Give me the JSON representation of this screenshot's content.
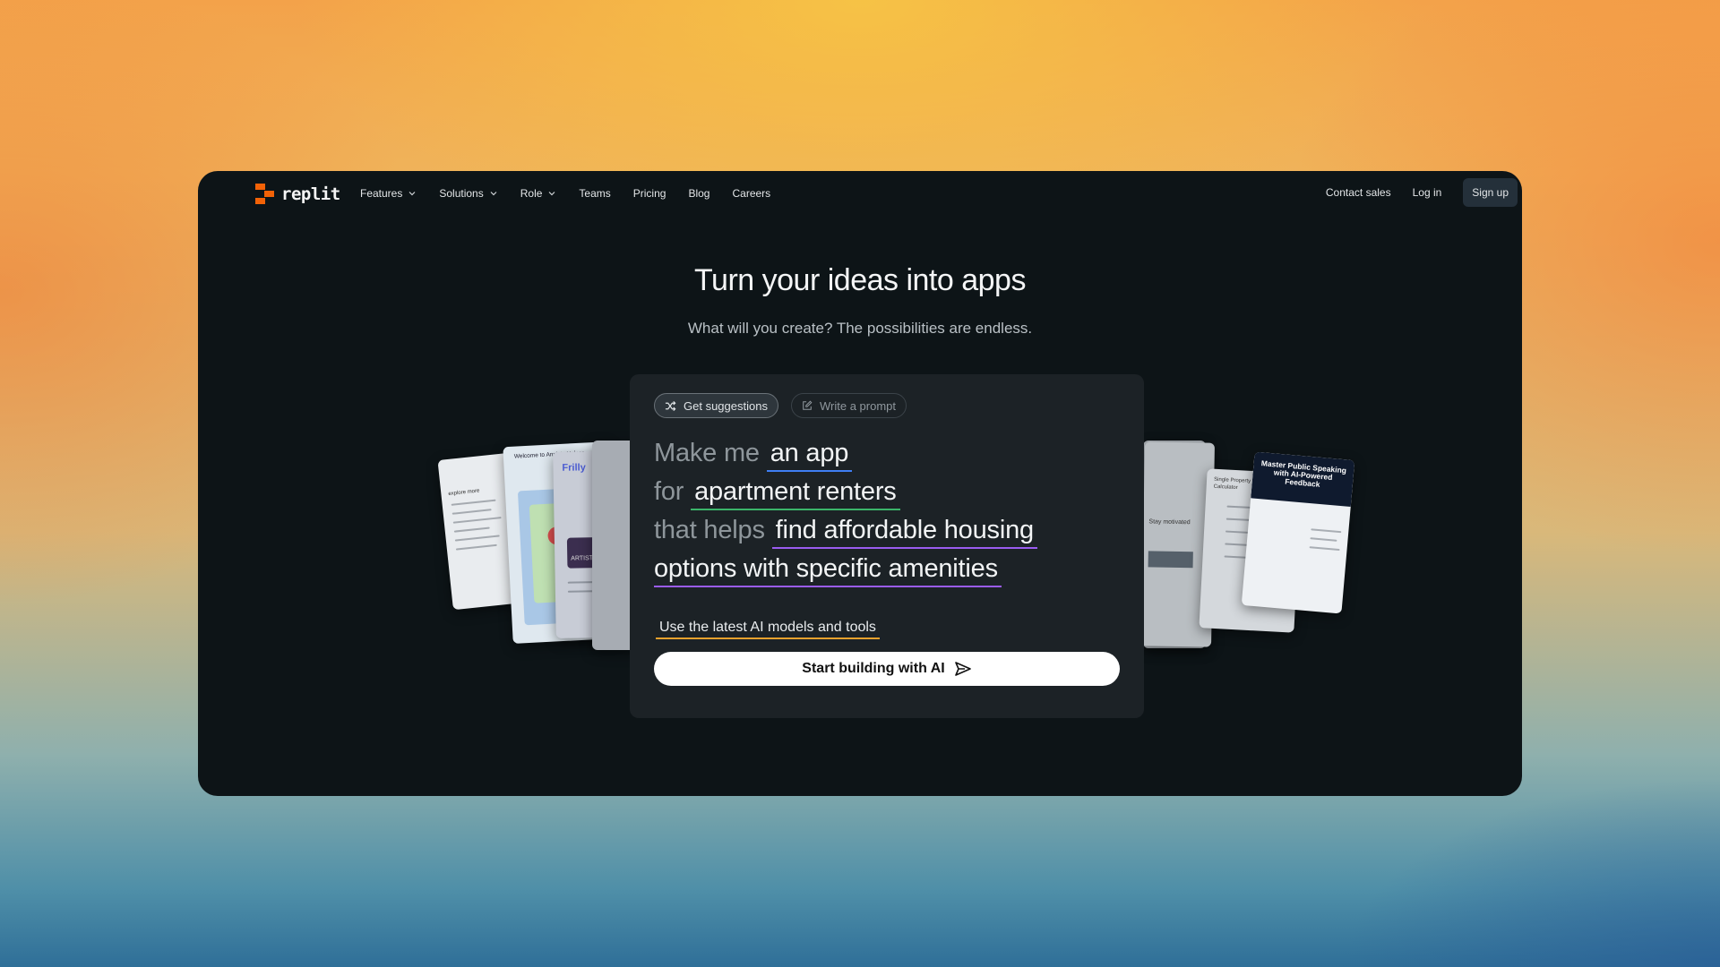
{
  "brand": {
    "logo_text": "replit",
    "accent": "#f26207"
  },
  "nav": {
    "items": [
      {
        "label": "Features",
        "dropdown": true
      },
      {
        "label": "Solutions",
        "dropdown": true
      },
      {
        "label": "Role",
        "dropdown": true
      },
      {
        "label": "Teams",
        "dropdown": false
      },
      {
        "label": "Pricing",
        "dropdown": false
      },
      {
        "label": "Blog",
        "dropdown": false
      },
      {
        "label": "Careers",
        "dropdown": false
      }
    ],
    "contact_sales": "Contact sales",
    "login": "Log in",
    "signup": "Sign up"
  },
  "hero": {
    "title": "Turn your ideas into apps",
    "subtitle": "What will you create? The possibilities are endless."
  },
  "prompt_card": {
    "tabs": {
      "suggestions": "Get suggestions",
      "write": "Write a prompt"
    },
    "line1_prefix": "Make me",
    "line1_value": "an app",
    "line2_prefix": "for",
    "line2_value": "apartment renters",
    "line3_prefix": "that helps",
    "line3_value": "find affordable housing",
    "line4_value": "options with specific amenities",
    "tools_label": "Use the latest AI models and tools",
    "cta_label": "Start building with AI"
  },
  "preview_cards": {
    "left_1": "explore more",
    "left_2": "Welcome to Anxiety Helper",
    "left_3": "Frilly",
    "left_4": "ARTIST",
    "right_1": "Stay motivated",
    "right_2": "Single Property Loan Calculator",
    "right_3": "Master Public Speaking with AI-Powered Feedback"
  },
  "colors": {
    "window_bg": "#0d1417",
    "card_bg": "#1c2226",
    "underline_blue": "#3f7ef3",
    "underline_green": "#3bb56a",
    "underline_purple": "#9a5cf0",
    "underline_orange": "#e9a12d"
  }
}
